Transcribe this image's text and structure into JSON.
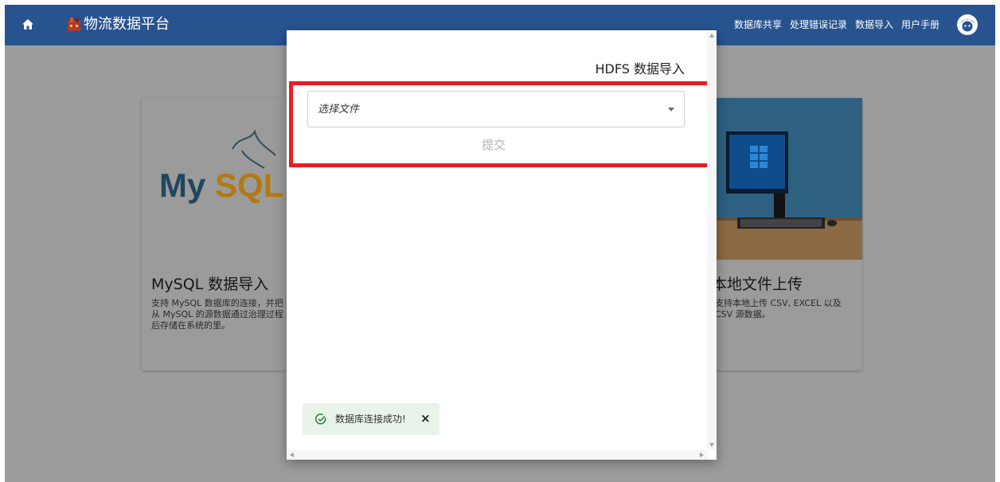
{
  "header": {
    "app_title": "物流数据平台",
    "nav": [
      "数据库共享",
      "处理错误记录",
      "数据导入",
      "用户手册"
    ],
    "home_icon": "home-icon",
    "logo_icon": "logo-icon",
    "avatar_icon": "avatar-icon",
    "bar_color": "#27538f"
  },
  "cards": {
    "mysql": {
      "title": "MySQL 数据导入",
      "logo_text_my": "My",
      "logo_text_sql": "SQL",
      "desc": [
        "支持 MySQL 数据库的连接，并把",
        "从 MySQL 的源数据通过治理过程",
        "后存储在系统的里。"
      ]
    },
    "local": {
      "title": "本地文件上传",
      "desc": [
        "支持本地上传 CSV, EXCEL 以及",
        "CSV 源数据。"
      ]
    }
  },
  "modal": {
    "title": "HDFS 数据导入",
    "file_select_placeholder": "选择文件",
    "submit_label": "提交",
    "highlight_color": "#ec1c24"
  },
  "toast": {
    "message": "数据库连接成功!",
    "close_label": "×",
    "icon": "check-circle-icon",
    "color": "#e8f3ea"
  }
}
